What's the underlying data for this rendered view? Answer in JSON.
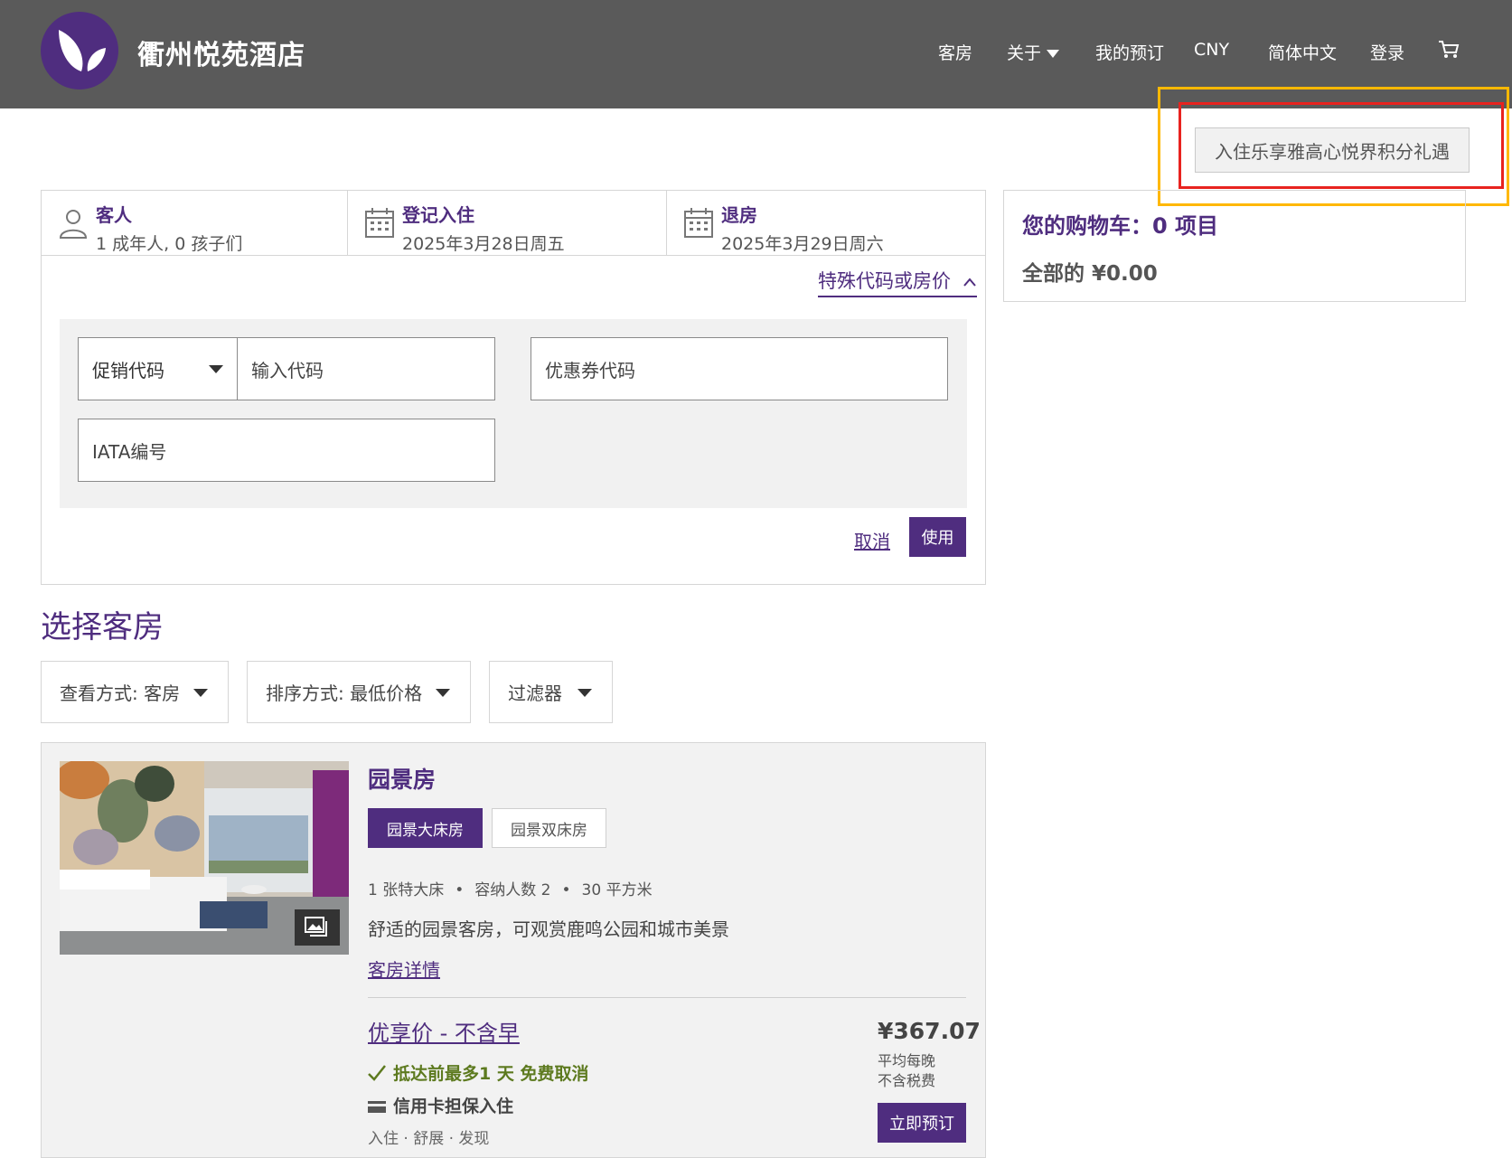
{
  "header": {
    "hotel_name": "衢州悦苑酒店",
    "nav": {
      "rooms": "客房",
      "about": "关于",
      "my_booking": "我的预订",
      "currency": "CNY",
      "language": "简体中文",
      "login": "登录"
    }
  },
  "loyalty_banner": "入住乐享雅高心悦界积分礼遇",
  "search": {
    "guests_label": "客人",
    "guests_value": "1 成年人, 0 孩子们",
    "checkin_label": "登记入住",
    "checkin_value": "2025年3月28日周五",
    "checkout_label": "退房",
    "checkout_value": "2025年3月29日周六",
    "special_codes_link": "特殊代码或房价",
    "promo_select": "促销代码",
    "promo_placeholder": "输入代码",
    "voucher_placeholder": "优惠券代码",
    "iata_placeholder": "IATA编号",
    "cancel": "取消",
    "apply": "使用"
  },
  "cart": {
    "title": "您的购物车：",
    "count": "0 项目",
    "total_label": "全部的",
    "total_value": "¥0.00"
  },
  "select_rooms": {
    "title": "选择客房",
    "view_by": "查看方式: 客房",
    "sort_by": "排序方式: 最低价格",
    "filter": "过滤器"
  },
  "room": {
    "name": "园景房",
    "tabs": [
      "园景大床房",
      "园景双床房"
    ],
    "specs": [
      "1 张特大床",
      "容纳人数 2",
      "30 平方米"
    ],
    "description": "舒适的园景客房，可观赏鹿鸣公园和城市美景",
    "details_link": "客房详情",
    "rate": {
      "name": "优享价 - 不含早",
      "cancellation": "抵达前最多1 天 免费取消",
      "guarantee": "信用卡担保入住",
      "amenities": "入住 · 舒展 · 发现",
      "price": "¥367.07",
      "per_night": "平均每晚",
      "tax_note": "不含税费",
      "book": "立即预订"
    }
  },
  "colors": {
    "brand_purple": "#4f2d7f",
    "header_gray": "#5a5a5a",
    "success_green": "#5d7a1f",
    "highlight_yellow": "#ffb800",
    "highlight_red": "#e8231f"
  }
}
